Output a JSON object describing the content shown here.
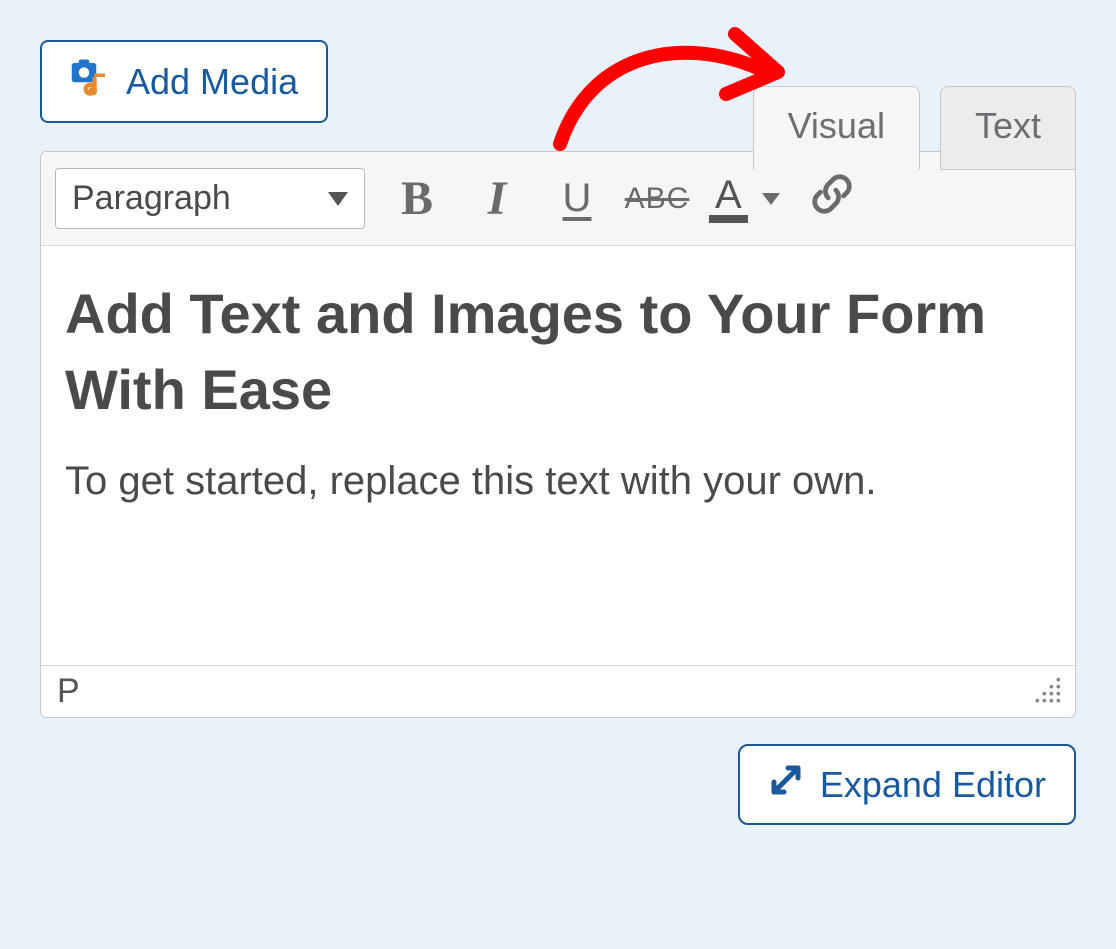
{
  "header": {
    "add_media_label": "Add Media"
  },
  "tabs": {
    "visual": "Visual",
    "text": "Text",
    "active": "visual"
  },
  "toolbar": {
    "format_select": "Paragraph",
    "bold": "B",
    "italic": "I",
    "underline": "U",
    "strike": "ABC",
    "text_color_letter": "A"
  },
  "content": {
    "heading": "Add Text and Images to Your Form With Ease",
    "body": "To get started, replace this text with your own."
  },
  "status": {
    "path": "P"
  },
  "footer": {
    "expand_label": "Expand Editor"
  },
  "annotation": {
    "type": "arrow",
    "color": "#ff0000",
    "points_to": "tab-visual"
  },
  "colors": {
    "page_bg": "#e9f2fb",
    "primary_blue": "#185a9d",
    "border_blue": "#195795",
    "toolbar_bg": "#f6f6f6",
    "border_gray": "#c9c9c9",
    "text_gray": "#4a4a4a",
    "muted_gray": "#6b6b6b"
  }
}
